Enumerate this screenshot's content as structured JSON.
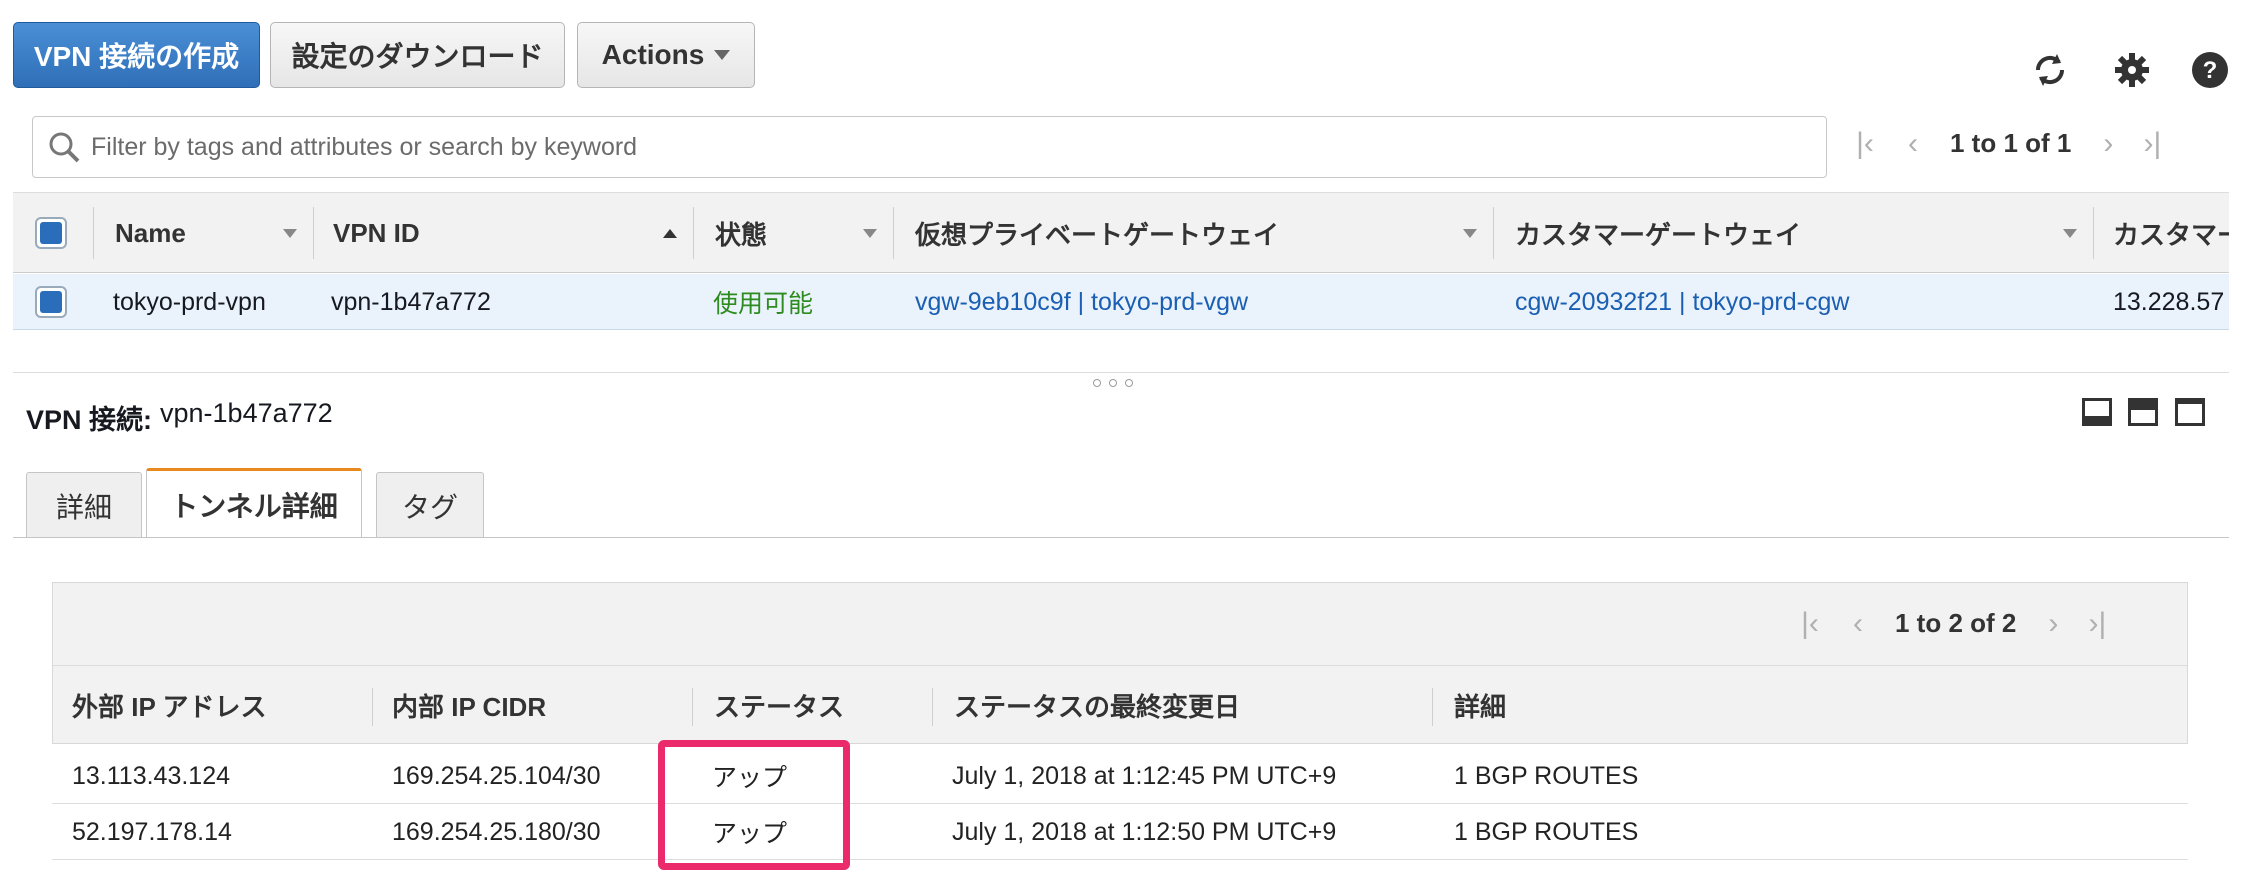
{
  "toolbar": {
    "create_vpn_label": "VPN 接続の作成",
    "download_config_label": "設定のダウンロード",
    "actions_label": "Actions"
  },
  "icons": {
    "refresh": "refresh-icon",
    "settings": "gear-icon",
    "help": "help-icon",
    "search": "search-icon"
  },
  "search": {
    "placeholder": "Filter by tags and attributes or search by keyword"
  },
  "pagination": {
    "top": "1 to 1 of 1",
    "tunnels": "1 to 2 of 2"
  },
  "table": {
    "columns": [
      "Name",
      "VPN ID",
      "状態",
      "仮想プライベートゲートウェイ",
      "カスタマーゲートウェイ",
      "カスタマー"
    ],
    "rows": [
      {
        "name": "tokyo-prd-vpn",
        "vpn_id": "vpn-1b47a772",
        "state": "使用可能",
        "vgw": "vgw-9eb10c9f | tokyo-prd-vgw",
        "cgw": "cgw-20932f21 | tokyo-prd-cgw",
        "customer_ip": "13.228.57"
      }
    ]
  },
  "detail": {
    "label": "VPN 接続:",
    "vpn_id": "vpn-1b47a772",
    "tabs": [
      "詳細",
      "トンネル詳細",
      "タグ"
    ],
    "active_tab": "トンネル詳細"
  },
  "tunnels": {
    "columns": [
      "外部 IP アドレス",
      "内部 IP CIDR",
      "ステータス",
      "ステータスの最終変更日",
      "詳細"
    ],
    "rows": [
      {
        "outside_ip": "13.113.43.124",
        "inside_cidr": "169.254.25.104/30",
        "status": "アップ",
        "last_change": "July 1, 2018 at 1:12:45 PM UTC+9",
        "detail": "1 BGP ROUTES"
      },
      {
        "outside_ip": "52.197.178.14",
        "inside_cidr": "169.254.25.180/30",
        "status": "アップ",
        "last_change": "July 1, 2018 at 1:12:50 PM UTC+9",
        "detail": "1 BGP ROUTES"
      }
    ]
  },
  "colors": {
    "primary": "#2f6fb8",
    "status_green": "#2e8b20",
    "link": "#1b5fb3",
    "highlight_border": "#ea2a6b",
    "tab_accent": "#e8891d"
  }
}
